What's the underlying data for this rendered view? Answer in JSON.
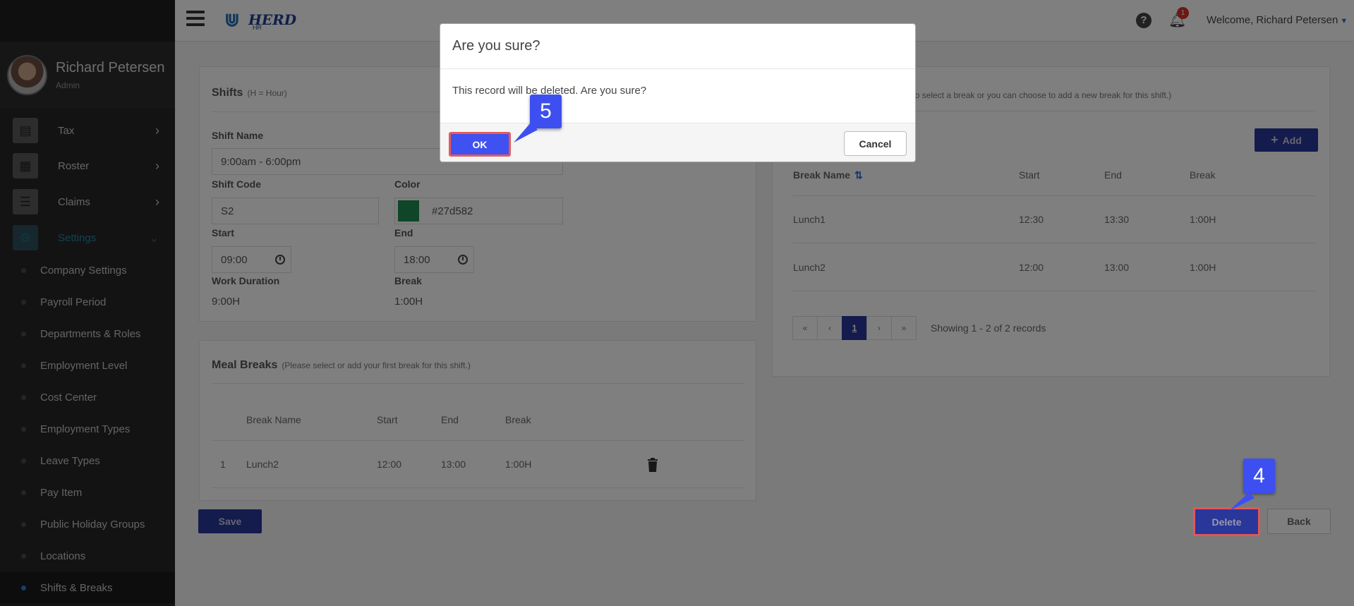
{
  "sidebar": {
    "profile": {
      "name": "Richard Petersen",
      "role": "Admin"
    },
    "main_items": [
      {
        "label": "Tax",
        "icon": "document-icon"
      },
      {
        "label": "Roster",
        "icon": "calendar-icon"
      },
      {
        "label": "Claims",
        "icon": "checklist-icon"
      },
      {
        "label": "Settings",
        "icon": "gears-icon"
      }
    ],
    "sub_items": [
      "Company Settings",
      "Payroll Period",
      "Departments & Roles",
      "Employment Level",
      "Cost Center",
      "Employment Types",
      "Leave Types",
      "Pay Item",
      "Public Holiday Groups",
      "Locations",
      "Shifts & Breaks"
    ]
  },
  "header": {
    "logo_text": "HERD",
    "logo_sub": "HR",
    "notification_count": "1",
    "welcome_label": "Welcome,",
    "user_name": "Richard Petersen"
  },
  "shifts": {
    "title": "Shifts",
    "title_note": "(H = Hour)",
    "shift_name_label": "Shift Name",
    "shift_name_value": "9:00am - 6:00pm",
    "shift_code_label": "Shift Code",
    "shift_code_value": "S2",
    "color_label": "Color",
    "color_value": "#27d582",
    "start_label": "Start",
    "start_value": "09:00",
    "end_label": "End",
    "end_value": "18:00",
    "work_duration_label": "Work Duration",
    "work_duration_value": "9:00H",
    "break_label": "Break",
    "break_value": "1:00H"
  },
  "meal_breaks": {
    "title": "Meal Breaks",
    "title_note": "(Please select or add your first break for this shift.)",
    "columns": [
      "Break Name",
      "Start",
      "End",
      "Break"
    ],
    "rows": [
      {
        "no": "1",
        "name": "Lunch2",
        "start": "12:00",
        "end": "13:00",
        "break": "1:00H"
      }
    ]
  },
  "breaks_panel": {
    "title_note": "ck to select a break or you can choose to add a new break for this shift.)",
    "add_label": "Add",
    "columns": [
      "Break Name",
      "Start",
      "End",
      "Break"
    ],
    "rows": [
      {
        "name": "Lunch1",
        "start": "12:30",
        "end": "13:30",
        "break": "1:00H"
      },
      {
        "name": "Lunch2",
        "start": "12:00",
        "end": "13:00",
        "break": "1:00H"
      }
    ],
    "pager": {
      "first": "«",
      "prev": "‹",
      "current": "1",
      "next": "›",
      "last": "»"
    },
    "records_text": "Showing 1 - 2 of 2 records"
  },
  "actions": {
    "save_label": "Save",
    "delete_label": "Delete",
    "back_label": "Back"
  },
  "dialog": {
    "title": "Are you sure?",
    "message": "This record will be deleted. Are you sure?",
    "ok_label": "OK",
    "cancel_label": "Cancel"
  },
  "callouts": {
    "step4": "4",
    "step5": "5"
  },
  "colors": {
    "primary": "#29379b",
    "callout": "#3d4ff0",
    "highlight": "#e25757",
    "swatch": "#1f8a52"
  }
}
